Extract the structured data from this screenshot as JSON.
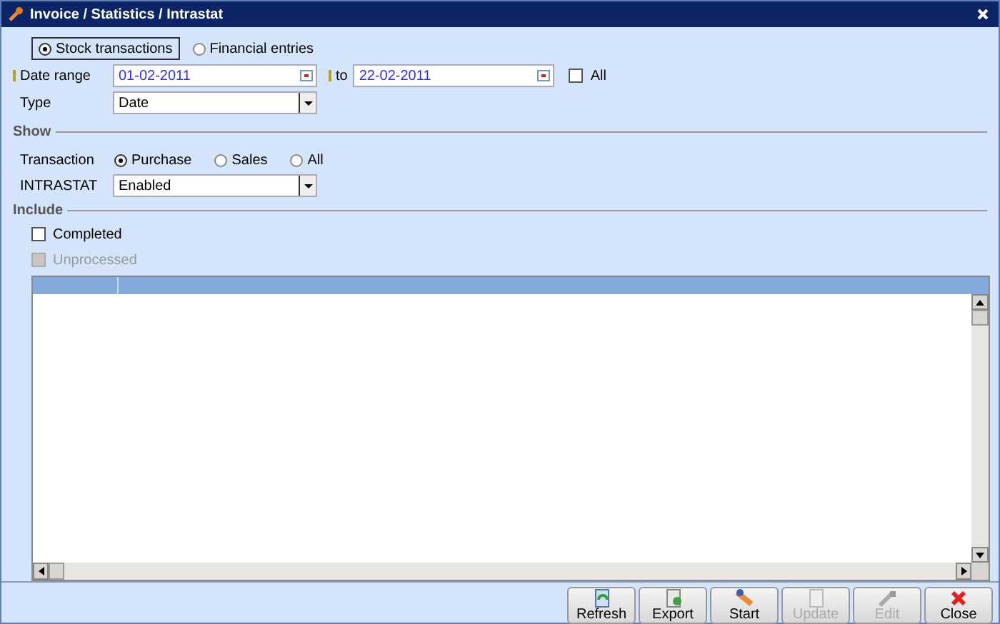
{
  "window": {
    "title": "Invoice / Statistics / Intrastat"
  },
  "mode_options": [
    {
      "label": "Stock transactions",
      "selected": true
    },
    {
      "label": "Financial entries",
      "selected": false
    }
  ],
  "date_range": {
    "label": "Date range",
    "from": "01-02-2011",
    "to_label": "to",
    "to": "22-02-2011",
    "all": {
      "label": "All",
      "checked": false
    }
  },
  "type": {
    "label": "Type",
    "value": "Date"
  },
  "show": {
    "title": "Show",
    "transaction": {
      "label": "Transaction",
      "options": [
        {
          "label": "Purchase",
          "selected": true
        },
        {
          "label": "Sales",
          "selected": false
        },
        {
          "label": "All",
          "selected": false
        }
      ]
    },
    "intrastat": {
      "label": "INTRASTAT",
      "value": "Enabled"
    }
  },
  "include": {
    "title": "Include",
    "options": [
      {
        "label": "Completed",
        "checked": false,
        "disabled": false
      },
      {
        "label": "Unprocessed",
        "checked": false,
        "disabled": true
      }
    ]
  },
  "buttons": [
    {
      "label": "Refresh",
      "kind": "refresh",
      "disabled": false
    },
    {
      "label": "Export",
      "kind": "export",
      "disabled": false
    },
    {
      "label": "Start",
      "kind": "start",
      "disabled": false
    },
    {
      "label": "Update",
      "kind": "update",
      "disabled": true
    },
    {
      "label": "Edit",
      "kind": "edit",
      "disabled": true
    },
    {
      "label": "Close",
      "kind": "close",
      "disabled": false
    }
  ]
}
